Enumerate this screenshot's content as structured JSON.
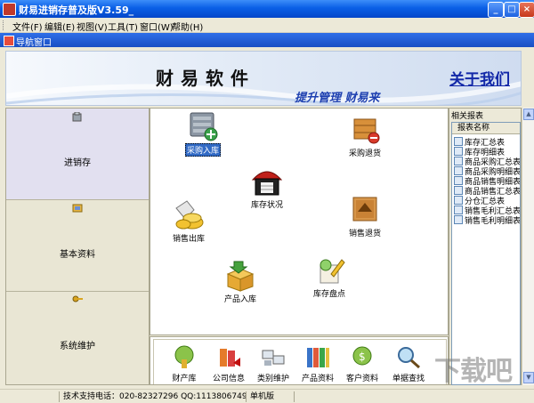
{
  "window": {
    "title": "财易进销存普及版V3.59_"
  },
  "menu": [
    "文件(F)",
    "编辑(E)",
    "视图(V)",
    "工具(T)",
    "窗口(W)",
    "帮助(H)"
  ],
  "nav_window": {
    "title": "导航窗口"
  },
  "banner": {
    "brand": "财易软件",
    "slogan": "提升管理 财易来",
    "about": "关于我们"
  },
  "left_nav": [
    {
      "label": "进销存",
      "icon": "box-icon",
      "active": true
    },
    {
      "label": "基本资料",
      "icon": "folder-icon",
      "active": false
    },
    {
      "label": "系统维护",
      "icon": "key-icon",
      "active": false
    }
  ],
  "tools": {
    "purchase_in": "采购入库",
    "purchase_return": "采购退货",
    "stock_status": "库存状况",
    "sales_out": "销售出库",
    "sales_return": "销售退货",
    "product_in": "产品入库",
    "stock_count": "库存盘点"
  },
  "bottom_tools": [
    "财产库",
    "公司信息",
    "类别维护",
    "产品资料",
    "客户资料",
    "单据查找"
  ],
  "reports": {
    "title": "相关报表",
    "header": "报表名称",
    "items": [
      "库存汇总表",
      "库存明细表",
      "商品采购汇总表",
      "商品采购明细表",
      "商品销售明细表",
      "商品销售汇总表",
      "分仓汇总表",
      "销售毛利汇总表",
      "销售毛利明细表"
    ]
  },
  "status": {
    "support": "技术支持电话：020-82327296 QQ:1113806749",
    "mode": "单机版"
  },
  "watermark": "下载吧",
  "colors": {
    "title_bar": "#0a5fe6",
    "accent": "#1228a8",
    "selection": "#316ac5"
  }
}
